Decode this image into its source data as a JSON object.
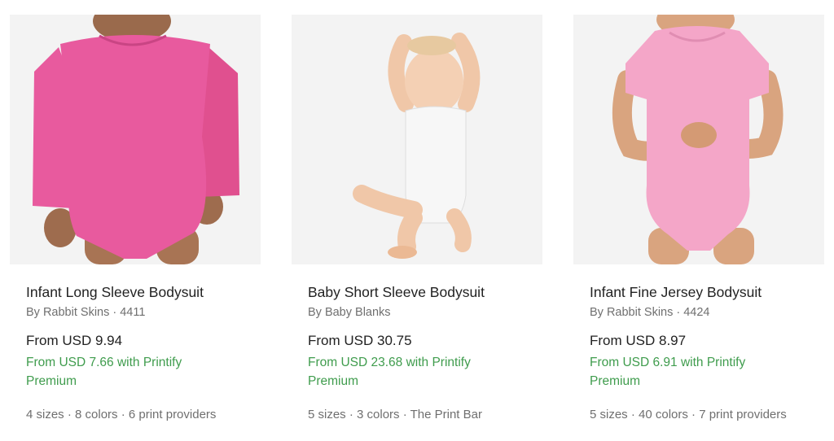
{
  "products": [
    {
      "title": "Infant Long Sleeve Bodysuit",
      "brand": "By Rabbit Skins · 4411",
      "price": "From USD 9.94",
      "premium_price": "From USD 7.66 with Printify Premium",
      "meta": "4 sizes · 8 colors · 6 print providers",
      "garment_color": "#e85a9e"
    },
    {
      "title": "Baby Short Sleeve Bodysuit",
      "brand": "By Baby Blanks",
      "price": "From USD 30.75",
      "premium_price": "From USD 23.68 with Printify Premium",
      "meta": "5 sizes · 3 colors · The Print Bar",
      "garment_color": "#f7f7f7"
    },
    {
      "title": "Infant Fine Jersey Bodysuit",
      "brand": "By Rabbit Skins · 4424",
      "price": "From USD 8.97",
      "premium_price": "From USD 6.91 with Printify Premium",
      "meta": "5 sizes · 40 colors · 7 print providers",
      "garment_color": "#f4a6c8"
    }
  ],
  "colors": {
    "title": "#222222",
    "secondary": "#6f6f6f",
    "premium": "#3f9c4d",
    "image_background": "#f3f3f3",
    "skin": "#d9a47f"
  }
}
